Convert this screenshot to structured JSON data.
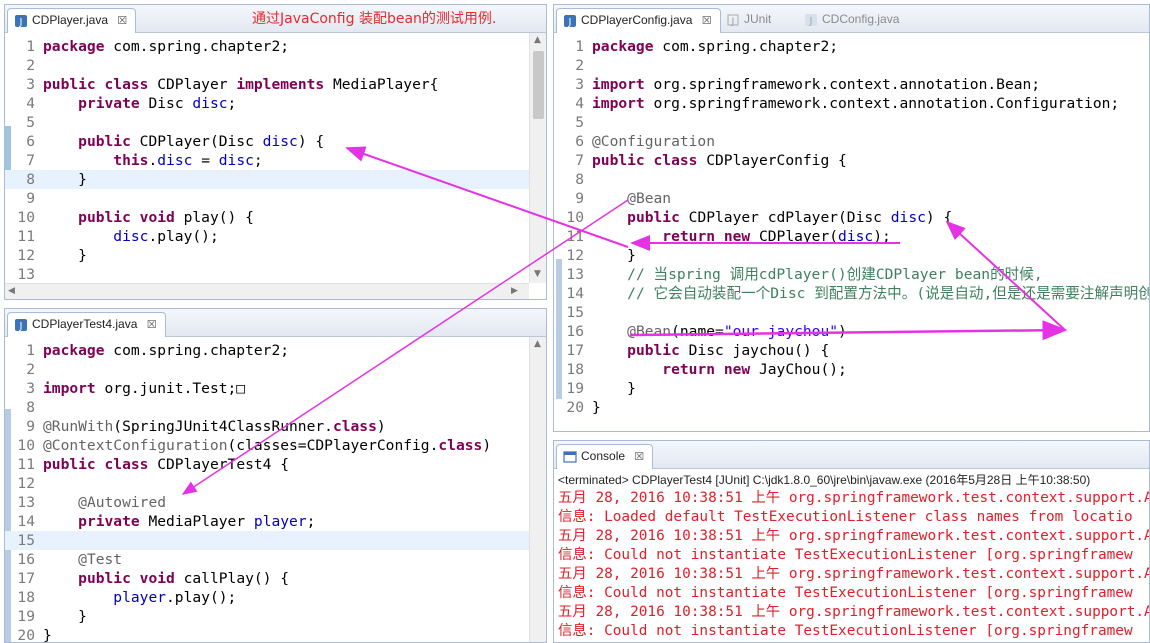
{
  "annotation": "通过JavaConfig 装配bean的测试用例.",
  "editor_left_top": {
    "tab": {
      "label": "CDPlayer.java",
      "close": "☒"
    },
    "lines": [
      {
        "n": "1",
        "text": "package com.spring.chapter2;"
      },
      {
        "n": "2",
        "text": ""
      },
      {
        "n": "3",
        "text": "public class CDPlayer implements MediaPlayer{"
      },
      {
        "n": "4",
        "text": "    private Disc disc;"
      },
      {
        "n": "5",
        "text": ""
      },
      {
        "n": "6",
        "text": "    public CDPlayer(Disc disc) {"
      },
      {
        "n": "7",
        "text": "        this.disc = disc;"
      },
      {
        "n": "8",
        "text": "    }"
      },
      {
        "n": "9",
        "text": ""
      },
      {
        "n": "10",
        "text": "    public void play() {"
      },
      {
        "n": "11",
        "text": "        disc.play();"
      },
      {
        "n": "12",
        "text": "    }"
      },
      {
        "n": "13",
        "text": ""
      }
    ]
  },
  "editor_left_bottom": {
    "tab": {
      "label": "CDPlayerTest4.java",
      "close": "☒"
    },
    "lines": [
      {
        "n": "1",
        "text": "package com.spring.chapter2;"
      },
      {
        "n": "2",
        "text": ""
      },
      {
        "n": "3",
        "text": "import org.junit.Test;□"
      },
      {
        "n": "8",
        "text": ""
      },
      {
        "n": "9",
        "text": "@RunWith(SpringJUnit4ClassRunner.class)"
      },
      {
        "n": "10",
        "text": "@ContextConfiguration(classes=CDPlayerConfig.class)"
      },
      {
        "n": "11",
        "text": "public class CDPlayerTest4 {"
      },
      {
        "n": "12",
        "text": ""
      },
      {
        "n": "13",
        "text": "    @Autowired"
      },
      {
        "n": "14",
        "text": "    private MediaPlayer player;"
      },
      {
        "n": "15",
        "text": ""
      },
      {
        "n": "16",
        "text": "    @Test"
      },
      {
        "n": "17",
        "text": "    public void callPlay() {"
      },
      {
        "n": "18",
        "text": "        player.play();"
      },
      {
        "n": "19",
        "text": "    }"
      },
      {
        "n": "20",
        "text": "}"
      }
    ]
  },
  "editor_right": {
    "tabs": [
      {
        "label": "CDPlayerConfig.java",
        "close": "☒",
        "active": true
      },
      {
        "label": "JUnit",
        "active": false
      },
      {
        "label": "CDConfig.java",
        "active": false
      }
    ],
    "lines": [
      {
        "n": "1",
        "text": "package com.spring.chapter2;"
      },
      {
        "n": "2",
        "text": ""
      },
      {
        "n": "3",
        "text": "import org.springframework.context.annotation.Bean;"
      },
      {
        "n": "4",
        "text": "import org.springframework.context.annotation.Configuration;"
      },
      {
        "n": "5",
        "text": ""
      },
      {
        "n": "6",
        "text": "@Configuration"
      },
      {
        "n": "7",
        "text": "public class CDPlayerConfig {"
      },
      {
        "n": "8",
        "text": ""
      },
      {
        "n": "9",
        "text": "    @Bean"
      },
      {
        "n": "10",
        "text": "    public CDPlayer cdPlayer(Disc disc) {"
      },
      {
        "n": "11",
        "text": "        return new CDPlayer(disc);"
      },
      {
        "n": "12",
        "text": "    }"
      },
      {
        "n": "13",
        "text": "    // 当spring 调用cdPlayer()创建CDPlayer bean的时候,"
      },
      {
        "n": "14",
        "text": "    // 它会自动装配一个Disc 到配置方法中。(说是自动,但是还是需要注解声明创建bean)"
      },
      {
        "n": "15",
        "text": ""
      },
      {
        "n": "16",
        "text": "    @Bean(name=\"our jaychou\")"
      },
      {
        "n": "17",
        "text": "    public Disc jaychou() {"
      },
      {
        "n": "18",
        "text": "        return new JayChou();"
      },
      {
        "n": "19",
        "text": "    }"
      },
      {
        "n": "20",
        "text": "}"
      }
    ]
  },
  "console": {
    "tab": {
      "label": "Console",
      "close": "☒"
    },
    "status": "<terminated> CDPlayerTest4 [JUnit] C:\\jdk1.8.0_60\\jre\\bin\\javaw.exe (2016年5月28日 上午10:38:50)",
    "lines": [
      "五月 28, 2016 10:38:51 上午 org.springframework.test.context.support.A",
      "信息: Loaded default TestExecutionListener class names from locatio",
      "五月 28, 2016 10:38:51 上午 org.springframework.test.context.support.A",
      "信息: Could not instantiate TestExecutionListener [org.springframew",
      "五月 28, 2016 10:38:51 上午 org.springframework.test.context.support.A",
      "信息: Could not instantiate TestExecutionListener [org.springframew",
      "五月 28, 2016 10:38:51 上午 org.springframework.test.context.support.A",
      "信息: Could not instantiate TestExecutionListener [org.springframew"
    ]
  },
  "colors": {
    "keyword": "#7f0055",
    "field": "#0000c0",
    "annotation": "#646464",
    "comment": "#3f7f5f",
    "string": "#2a00ff",
    "arrow": "#e532e5",
    "console_text": "#e0202a"
  }
}
